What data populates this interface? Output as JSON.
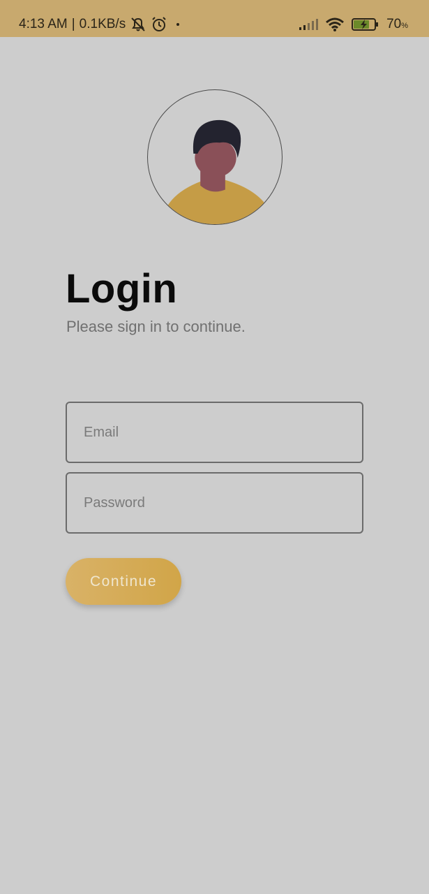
{
  "status_bar": {
    "time": "4:13 AM",
    "network_speed": "0.1KB/s",
    "battery_percent": "70",
    "battery_unit": "%",
    "icons": [
      "mute-icon",
      "alarm-icon",
      "dot-icon",
      "signal-icon",
      "wifi-icon",
      "battery-charging-icon"
    ]
  },
  "login": {
    "title": "Login",
    "subtitle": "Please sign in to continue.",
    "email_placeholder": "Email",
    "password_placeholder": "Password",
    "continue_label": "Continue"
  },
  "colors": {
    "status_bar_bg": "#c8a96e",
    "background": "#cdcdcd",
    "accent": "#d4aa52",
    "avatar_shirt": "#c59c46",
    "avatar_face": "#8a5058",
    "avatar_hair": "#23232f"
  }
}
